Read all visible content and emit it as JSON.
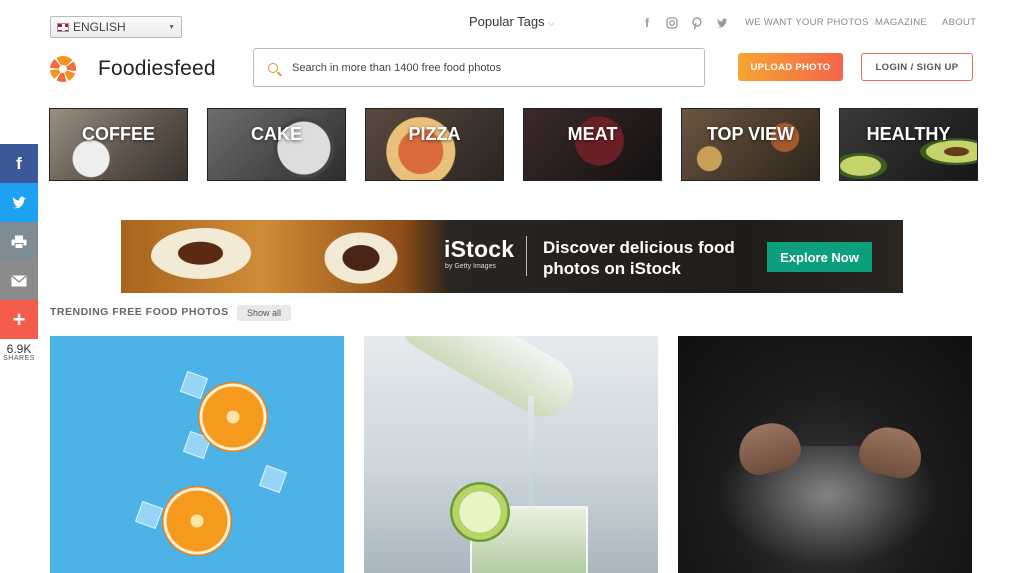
{
  "header": {
    "language": "ENGLISH",
    "popular_tags": "Popular Tags",
    "nav": [
      "WE WANT YOUR PHOTOS",
      "MAGAZINE",
      "ABOUT"
    ],
    "social_icons": [
      "facebook-icon",
      "instagram-icon",
      "pinterest-icon",
      "twitter-icon"
    ]
  },
  "brand": {
    "name": "Foodiesfeed"
  },
  "search": {
    "placeholder": "Search in more than 1400 free food photos"
  },
  "buttons": {
    "upload": "UPLOAD PHOTO",
    "login": "LOGIN / SIGN UP"
  },
  "categories": [
    "COFFEE",
    "CAKE",
    "PIZZA",
    "MEAT",
    "TOP VIEW",
    "HEALTHY"
  ],
  "share_bar": {
    "count": "6.9K",
    "label": "SHARES"
  },
  "ad": {
    "brand": "iStock",
    "brand_sub": "by Getty Images",
    "message": "Discover delicious food photos on iStock",
    "cta": "Explore Now"
  },
  "trending": {
    "title": "TRENDING FREE FOOD PHOTOS",
    "show_all": "Show all"
  },
  "colors": {
    "accent_start": "#f7a531",
    "accent_end": "#f3644b",
    "ad_cta": "#0d9e7e"
  }
}
